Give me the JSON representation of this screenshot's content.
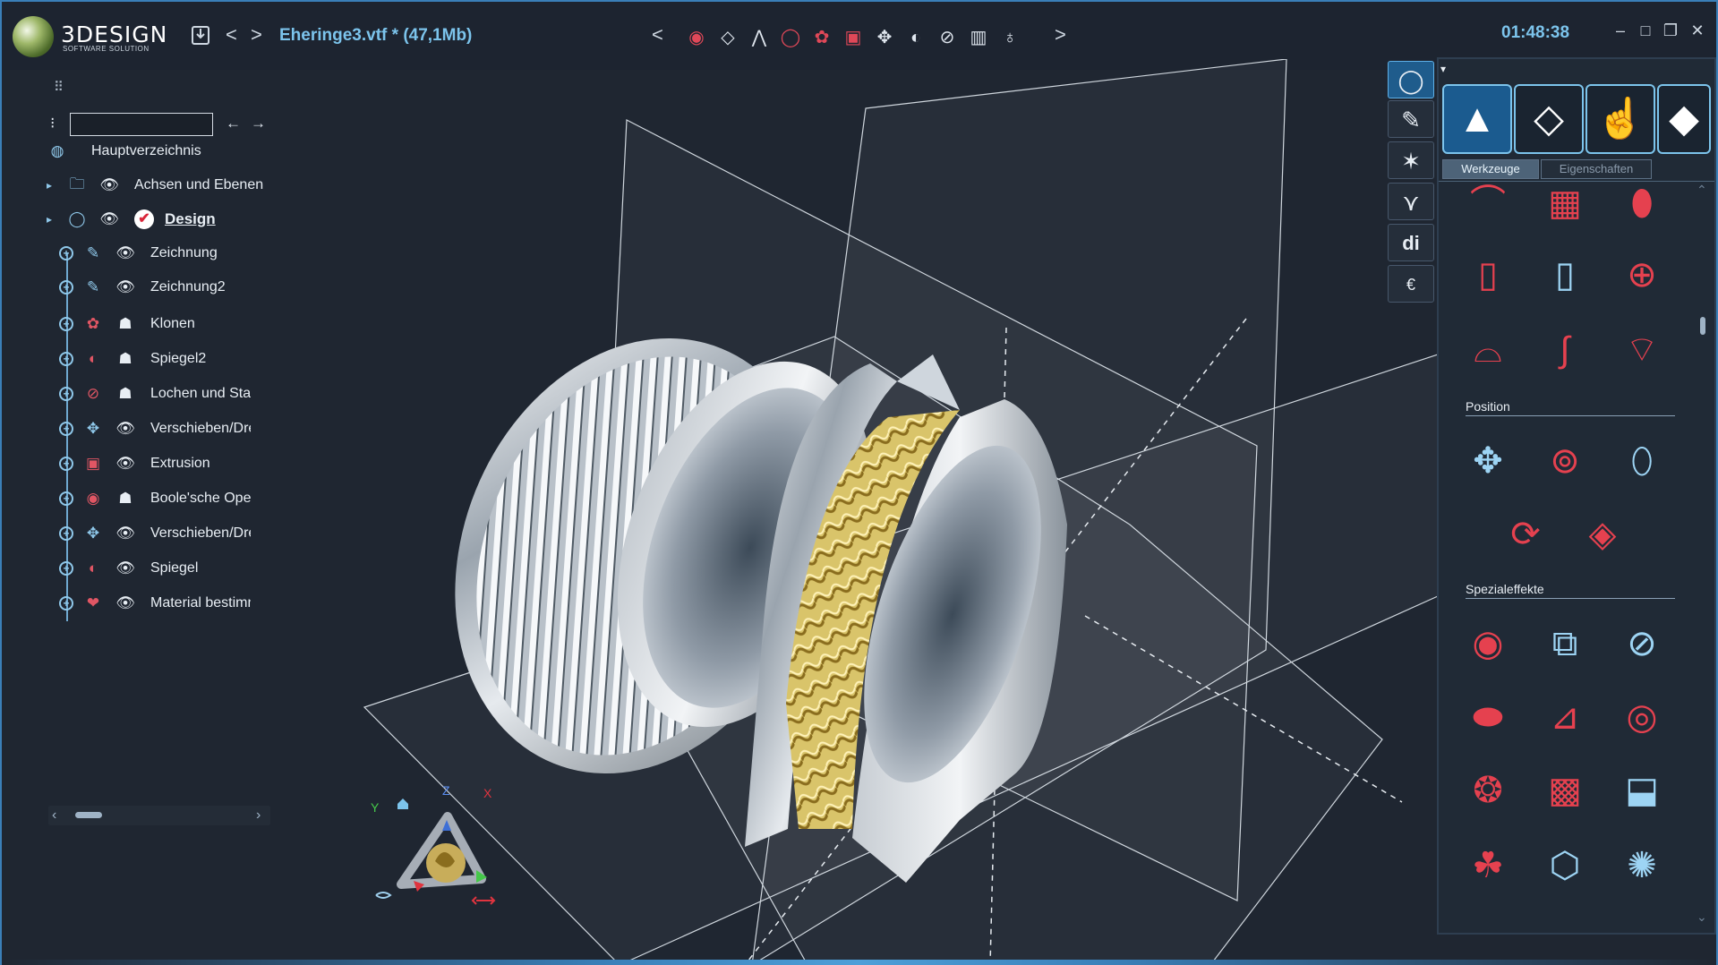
{
  "app": {
    "logo_name": "3DESIGN",
    "logo_sub": "SOFTWARE SOLUTION",
    "file_title": "Eheringe3.vtf *  (47,1Mb)",
    "clock": "01:48:38"
  },
  "titlebar": {
    "nav_back": "<",
    "nav_forward": ">",
    "strip_prev": "<",
    "strip_next": ">",
    "save_icon": "save-icon"
  },
  "toolstrip": [
    {
      "icon": "boolean-icon",
      "glyph": "◉"
    },
    {
      "icon": "gem-icon",
      "glyph": "◇",
      "white": true
    },
    {
      "icon": "prong-icon",
      "glyph": "⋀",
      "white": true
    },
    {
      "icon": "ring-icon",
      "glyph": "◯"
    },
    {
      "icon": "clone-icon",
      "glyph": "✿"
    },
    {
      "icon": "extrude-icon",
      "glyph": "▣"
    },
    {
      "icon": "transform-icon",
      "glyph": "✥",
      "white": true
    },
    {
      "icon": "mirror-icon",
      "glyph": "◐",
      "white": true
    },
    {
      "icon": "pierce-icon",
      "glyph": "⊘",
      "white": true
    },
    {
      "icon": "ruler-icon",
      "glyph": "▥",
      "white": true
    },
    {
      "icon": "pendant-icon",
      "glyph": "♁",
      "white": true
    }
  ],
  "tree": {
    "search_value": "",
    "root": "Hauptverzeichnis",
    "items": [
      {
        "label": "Achsen und Ebenen",
        "type_icon": "folder-icon",
        "vis_icon": "eye-icon"
      },
      {
        "label": "Design",
        "type_icon": "ring-icon",
        "vis_icon": "eye-icon",
        "status_icon": "check-icon"
      },
      {
        "label": "Zeichnung",
        "type_icon": "pen-icon",
        "vis_icon": "eye-icon"
      },
      {
        "label": "Zeichnung2",
        "type_icon": "pen-icon",
        "vis_icon": "eye-icon"
      },
      {
        "label": "Klonen",
        "type_icon": "clone-icon",
        "vis_icon": "ghost-icon"
      },
      {
        "label": "Spiegel2",
        "type_icon": "mirror-icon",
        "vis_icon": "ghost-icon"
      },
      {
        "label": "Lochen und Stan",
        "type_icon": "pierce-icon",
        "vis_icon": "ghost-icon"
      },
      {
        "label": "Verschieben/Drel",
        "type_icon": "transform-icon",
        "vis_icon": "eye-icon"
      },
      {
        "label": "Extrusion",
        "type_icon": "extrude-icon",
        "vis_icon": "eye-icon"
      },
      {
        "label": "Boole'sche Opera",
        "type_icon": "boolean-icon",
        "vis_icon": "ghost-icon"
      },
      {
        "label": "Verschieben/Drel",
        "type_icon": "transform-icon",
        "vis_icon": "eye-icon"
      },
      {
        "label": "Spiegel",
        "type_icon": "mirror-icon",
        "vis_icon": "eye-icon"
      },
      {
        "label": "Material bestimm",
        "type_icon": "material-icon",
        "vis_icon": "eye-icon"
      }
    ]
  },
  "navigator": {
    "x_label": "X",
    "y_label": "Y",
    "z_label": "Z"
  },
  "mode_buttons": [
    {
      "icon": "ring-mode-icon",
      "glyph": "◯"
    },
    {
      "icon": "sketch-mode-icon",
      "glyph": "✎"
    },
    {
      "icon": "mesh-mode-icon",
      "glyph": "✶"
    },
    {
      "icon": "prong-mode-icon",
      "glyph": "⋎"
    },
    {
      "icon": "di-mode-icon",
      "glyph": "di"
    },
    {
      "icon": "price-mode-icon",
      "glyph": "€"
    }
  ],
  "right_panel": {
    "tabs": [
      "Werkzeuge",
      "Eigenschaften"
    ],
    "sections": [
      "Position",
      "Spezialeffekte"
    ],
    "categories": [
      {
        "icon": "primitives-icon",
        "glyph": "▲"
      },
      {
        "icon": "diamond-icon",
        "glyph": "◇"
      },
      {
        "icon": "ring-hand-icon",
        "glyph": "☝"
      },
      {
        "icon": "puzzle-icon",
        "glyph": "◆"
      }
    ]
  },
  "colors": {
    "accent": "#7cc4ec",
    "tool_red": "#e5414f",
    "active_blue": "#1b5b8f",
    "gold": "#d9c46a"
  }
}
